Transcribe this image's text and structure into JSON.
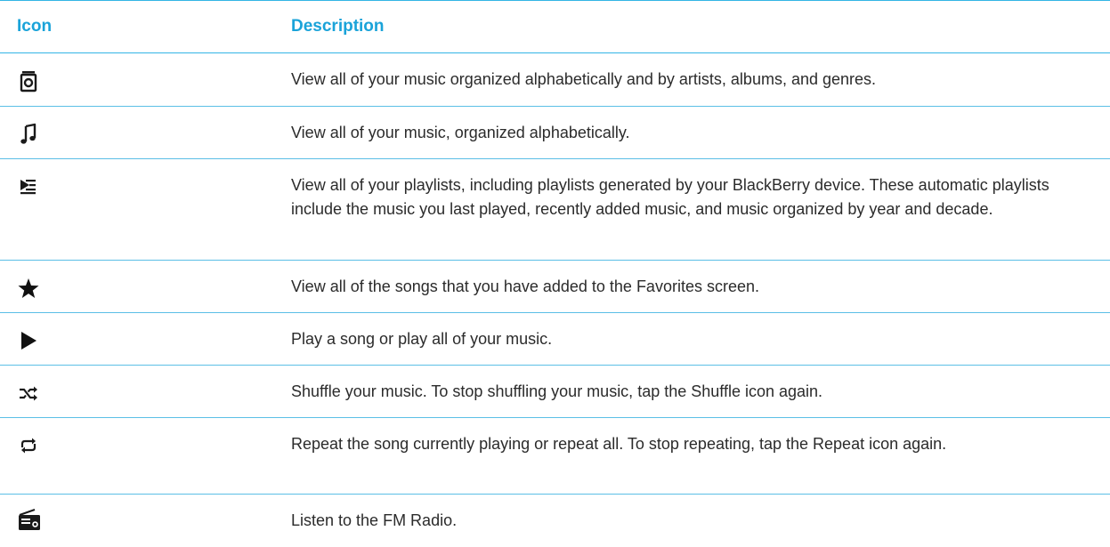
{
  "table": {
    "header": {
      "icon_col": "Icon",
      "desc_col": "Description"
    },
    "rows": [
      {
        "icon": "music-library-icon",
        "description": "View all of your music organized alphabetically and by artists, albums, and genres."
      },
      {
        "icon": "music-note-icon",
        "description": "View all of your music, organized alphabetically."
      },
      {
        "icon": "playlist-icon",
        "description": "View all of your playlists, including playlists generated by your BlackBerry device. These automatic playlists include the music you last played, recently added music, and music organized by year and decade."
      },
      {
        "icon": "star-icon",
        "description": "View all of the songs that you have added to the Favorites screen."
      },
      {
        "icon": "play-icon",
        "description": "Play a song or play all of your music."
      },
      {
        "icon": "shuffle-icon",
        "description": "Shuffle your music. To stop shuffling your music, tap the Shuffle icon again."
      },
      {
        "icon": "repeat-icon",
        "description": "Repeat the song currently playing or repeat all. To stop repeating, tap the Repeat icon again."
      },
      {
        "icon": "radio-icon",
        "description": "Listen to the FM Radio."
      }
    ]
  },
  "colors": {
    "header_text": "#1aa3d9",
    "rule": "#33b5e5",
    "body_text": "#2b2b2b"
  }
}
